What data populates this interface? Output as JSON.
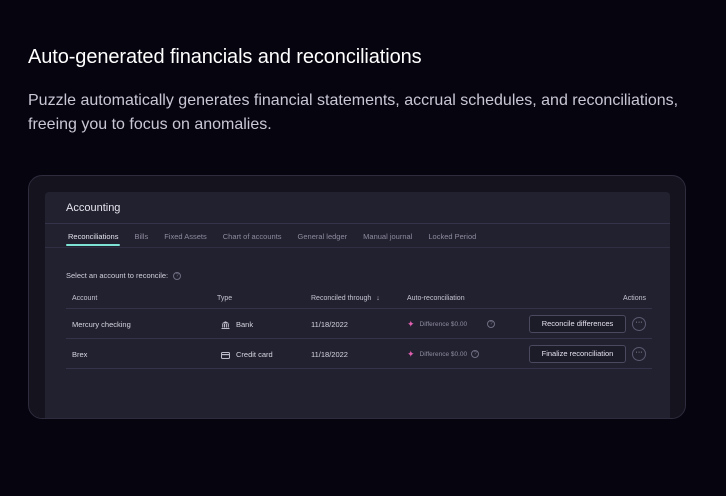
{
  "hero": {
    "title": "Auto-generated financials and reconciliations",
    "description": "Puzzle automatically generates financial statements, accrual schedules, and reconciliations, freeing you to focus on anomalies."
  },
  "panel": {
    "title": "Accounting",
    "tabs": [
      {
        "label": "Reconciliations",
        "active": true
      },
      {
        "label": "Bills"
      },
      {
        "label": "Fixed Assets"
      },
      {
        "label": "Chart of accounts"
      },
      {
        "label": "General ledger"
      },
      {
        "label": "Manual journal"
      },
      {
        "label": "Locked Period"
      }
    ],
    "select_label": "Select an account to reconcile:",
    "help_glyph": "?",
    "table": {
      "headers": {
        "account": "Account",
        "type": "Type",
        "reconciled_through": "Reconciled through",
        "sort_arrow": "↓",
        "auto_reconciliation": "Auto-reconciliation",
        "actions": "Actions"
      },
      "rows": [
        {
          "account": "Mercury checking",
          "type": "Bank",
          "type_icon": "bank-icon",
          "reconciled_through": "11/18/2022",
          "auto": "Difference $0.00",
          "action": "Reconcile differences",
          "more": "···"
        },
        {
          "account": "Brex",
          "type": "Credit card",
          "type_icon": "credit-card-icon",
          "reconciled_through": "11/18/2022",
          "auto": "Difference $0.00",
          "action": "Finalize reconciliation",
          "more": "···"
        }
      ]
    }
  },
  "colors": {
    "background": "#05040f",
    "panel": "#22212f",
    "accent_tab": "#7ee3d4",
    "sparkle": "#e05fb1"
  }
}
